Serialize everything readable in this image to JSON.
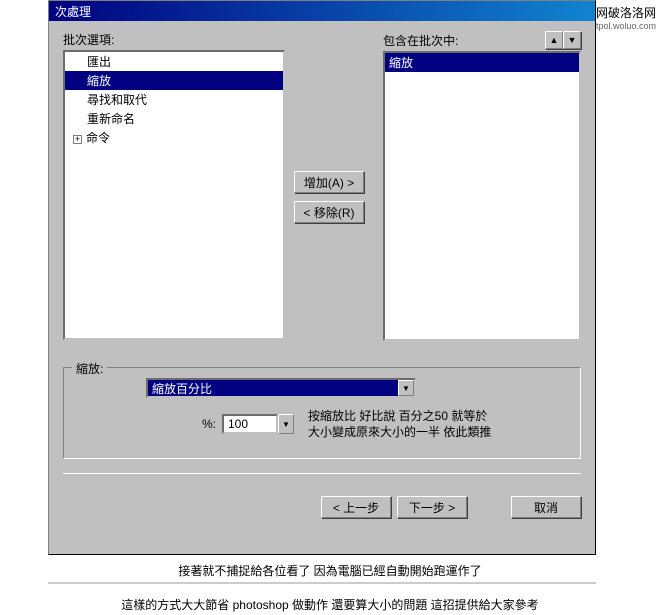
{
  "window": {
    "title": "次處理"
  },
  "watermark": {
    "main": "网破洛洛网",
    "sub": "tpol.woluo.com"
  },
  "labels": {
    "batch_options": "批次選項:",
    "included_in_batch": "包含在批次中:"
  },
  "tree": {
    "items": [
      {
        "label": "匯出",
        "indent": true
      },
      {
        "label": "縮放",
        "indent": true,
        "selected": true
      },
      {
        "label": "尋找和取代",
        "indent": true
      },
      {
        "label": "重新命名",
        "indent": true
      },
      {
        "label": "命令",
        "indent": false,
        "expander": "+"
      }
    ]
  },
  "included_list": {
    "items": [
      {
        "label": "縮放",
        "selected": true
      }
    ]
  },
  "mid_buttons": {
    "add": "增加(A) >",
    "remove": "< 移除(R)"
  },
  "arrow_up": "▲",
  "arrow_down": "▼",
  "panel": {
    "legend": "縮放:",
    "dropdown_value": "縮放百分比",
    "percent_label": "%:",
    "percent_value": "100",
    "annotation_line1": "按縮放比 好比說 百分之50 就等於",
    "annotation_line2": "大小變成原來大小的一半 依此類推"
  },
  "nav_buttons": {
    "back": "< 上一步",
    "next": "下一步 >",
    "cancel": "取消"
  },
  "captions": {
    "c1": "接著就不捕捉給各位看了 因為電腦已經自動開始跑運作了",
    "c2": "這樣的方式大大節省 photoshop 做動作 還要算大小的問題 這招提供給大家參考"
  }
}
